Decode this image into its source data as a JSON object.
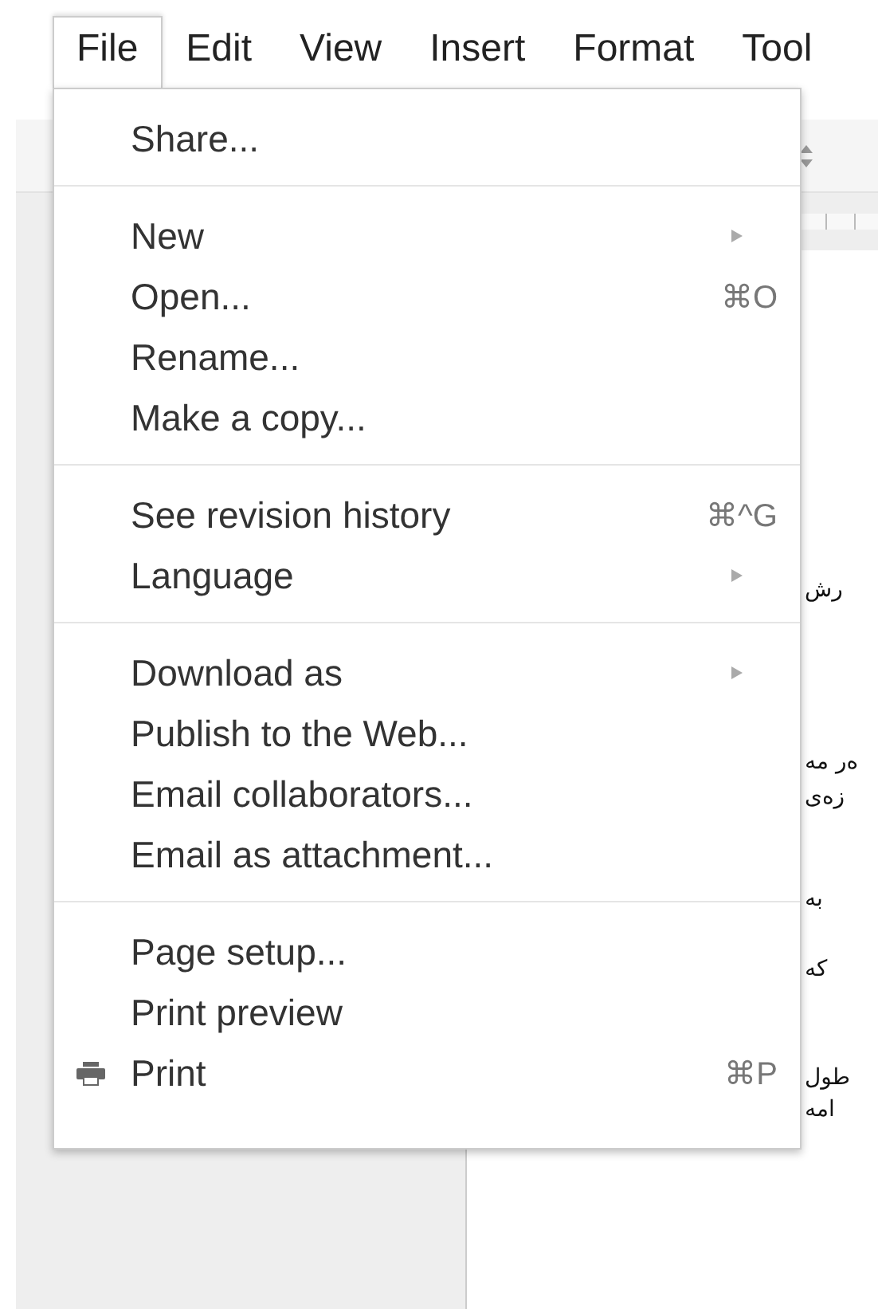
{
  "menu_bar": [
    {
      "label": "File",
      "selected": true
    },
    {
      "label": "Edit",
      "selected": false
    },
    {
      "label": "View",
      "selected": false
    },
    {
      "label": "Insert",
      "selected": false
    },
    {
      "label": "Format",
      "selected": false
    },
    {
      "label": "Tool",
      "selected": false
    }
  ],
  "file_menu": {
    "sections": [
      [
        {
          "kind": "plain",
          "label": "Share..."
        }
      ],
      [
        {
          "kind": "submenu",
          "label": "New"
        },
        {
          "kind": "shortcut",
          "label": "Open...",
          "shortcut": "⌘O"
        },
        {
          "kind": "plain",
          "label": "Rename..."
        },
        {
          "kind": "plain",
          "label": "Make a copy..."
        }
      ],
      [
        {
          "kind": "shortcut",
          "label": "See revision history",
          "shortcut": "⌘^G"
        },
        {
          "kind": "submenu",
          "label": "Language"
        }
      ],
      [
        {
          "kind": "submenu",
          "label": "Download as"
        },
        {
          "kind": "plain",
          "label": "Publish to the Web..."
        },
        {
          "kind": "plain",
          "label": "Email collaborators..."
        },
        {
          "kind": "plain",
          "label": "Email as attachment..."
        }
      ],
      [
        {
          "kind": "plain",
          "label": "Page setup..."
        },
        {
          "kind": "plain",
          "label": "Print preview"
        },
        {
          "kind": "icon_shortcut",
          "label": "Print",
          "shortcut": "⌘P"
        }
      ]
    ]
  },
  "document_text": [
    "رش",
    "ەر مە",
    "زەی",
    "بە",
    "کە",
    "طول",
    "امە"
  ]
}
